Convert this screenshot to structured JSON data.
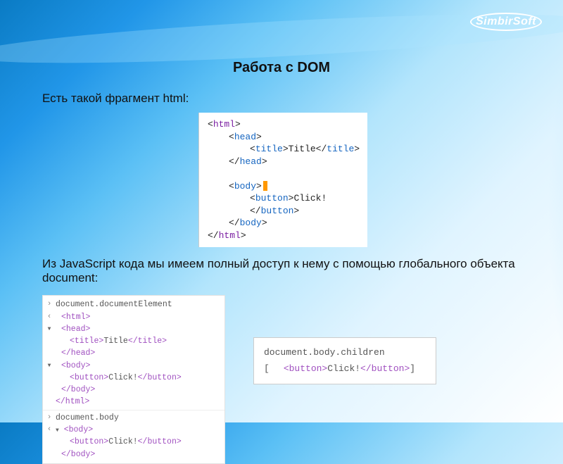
{
  "brand": {
    "name": "SimbirSoft"
  },
  "title": "Работа с DOM",
  "intro": "Есть такой фрагмент html:",
  "middle": "Из JavaScript кода мы имеем полный доступ к нему с помощью глобального объекта document:",
  "code1": {
    "l1_open": "<",
    "l1_tag": "html",
    "l1_close": ">",
    "l2_open": "<",
    "l2_tag": "head",
    "l2_close": ">",
    "l3_open": "<",
    "l3_tag": "title",
    "l3_mid": ">",
    "l3_txt": "Title",
    "l3_eo": "</",
    "l3_ec": ">",
    "l4_open": "</",
    "l4_tag": "head",
    "l4_close": ">",
    "l5_open": "<",
    "l5_tag": "body",
    "l5_close": ">",
    "l6_open": "<",
    "l6_tag": "button",
    "l6_mid": ">",
    "l6_txt": "Click!",
    "l6_eo": "</",
    "l6_ec": ">",
    "l7_open": "</",
    "l7_tag": "body",
    "l7_close": ">",
    "l8_open": "</",
    "l8_tag": "html",
    "l8_close": ">"
  },
  "code2": {
    "r0": "document.documentElement",
    "r1": "<html>",
    "r2": "<head>",
    "r3a": "<title>",
    "r3b": "Title",
    "r3c": "</title>",
    "r4": "</head>",
    "r5": "<body>",
    "r6a": "<button>",
    "r6b": "Click!",
    "r6c": "</button>",
    "r7": "</body>",
    "r8": "</html>",
    "r9": "document.body",
    "r10": "<body>",
    "r11a": "<button>",
    "r11b": "Click!",
    "r11c": "</button>",
    "r12": "</body>"
  },
  "code3": {
    "line1": "document.body.children",
    "br_open": "[",
    "gap": "",
    "tag_o": "<button>",
    "txt": "Click!",
    "tag_c": "</button>",
    "br_close": "]"
  }
}
